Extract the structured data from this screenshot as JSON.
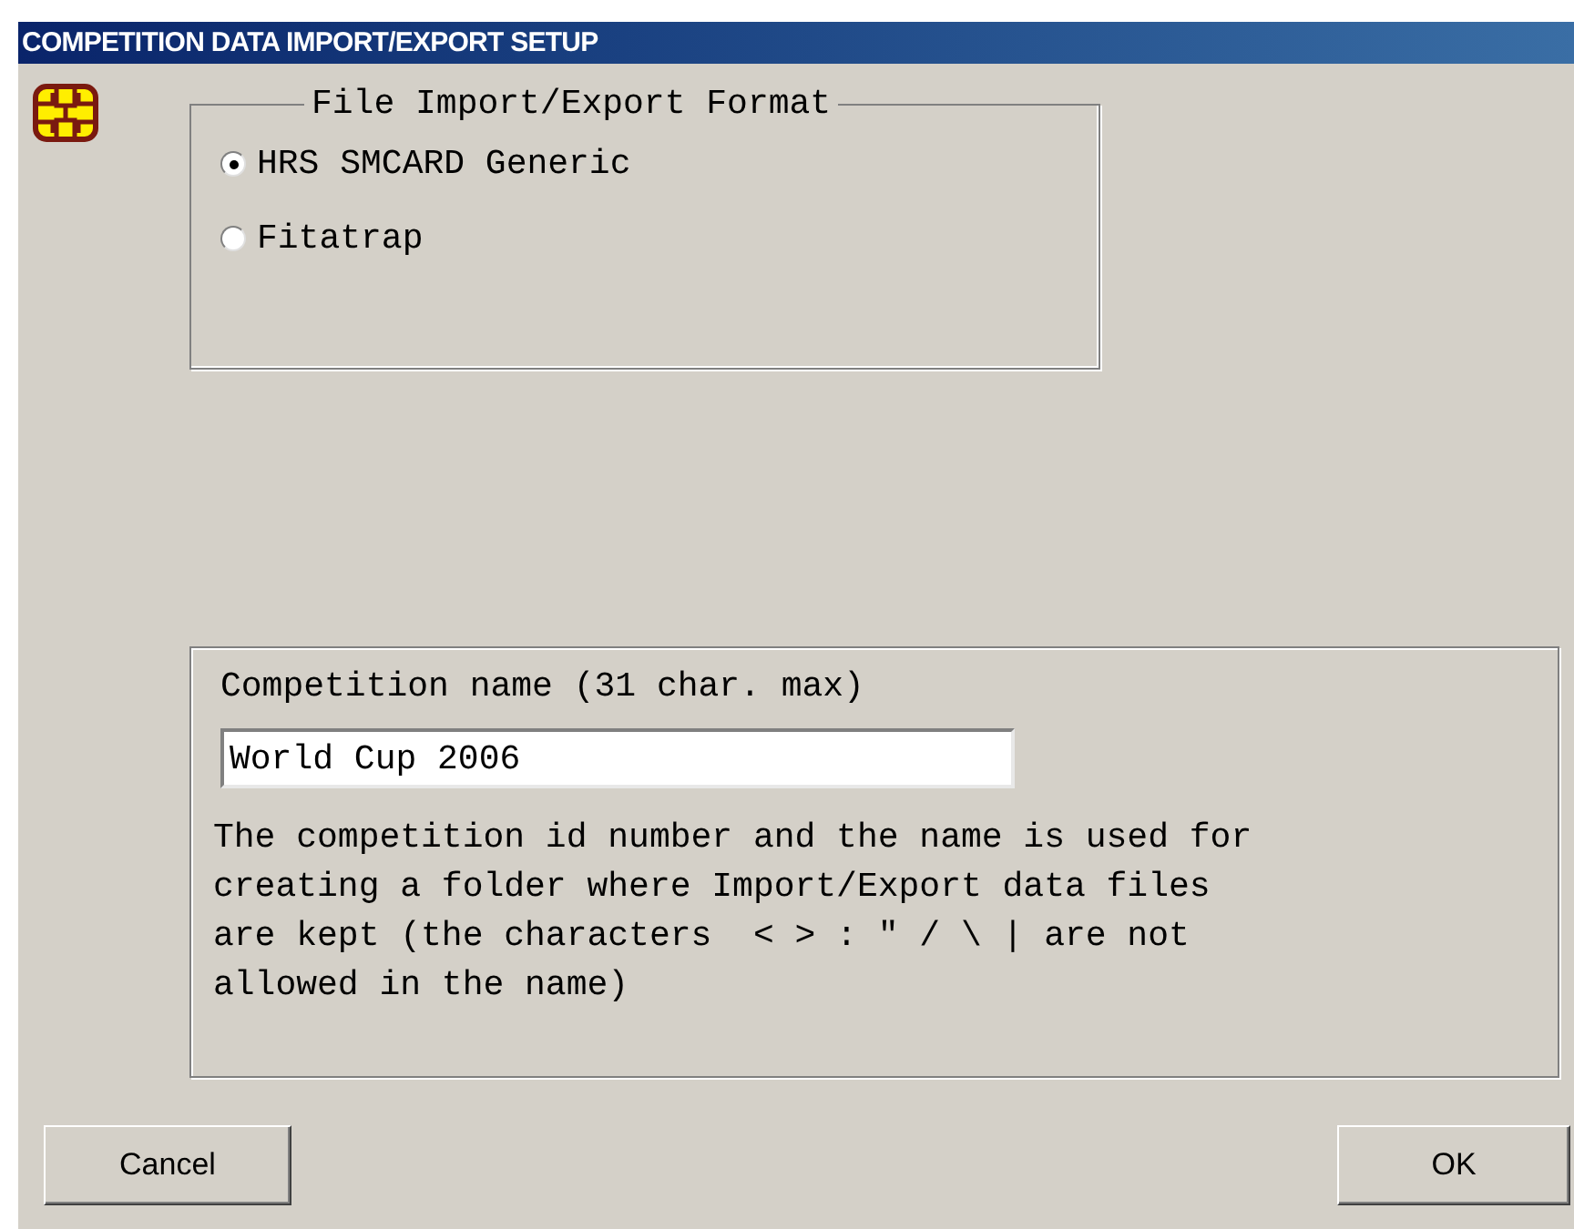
{
  "window": {
    "title": "COMPETITION DATA IMPORT/EXPORT SETUP"
  },
  "format_group": {
    "legend": "File Import/Export Format",
    "options": [
      {
        "label": "HRS SMCARD Generic",
        "selected": true
      },
      {
        "label": "Fitatrap",
        "selected": false
      }
    ]
  },
  "name_group": {
    "label": "Competition name (31 char. max)",
    "value": "World Cup 2006",
    "description": "The competition id number and the name is used for creating a folder where Import/Export data files are kept (the characters  < > : \" / \\ | are not allowed in the name)"
  },
  "buttons": [
    {
      "label": "Cancel"
    },
    {
      "label": "OK"
    }
  ]
}
